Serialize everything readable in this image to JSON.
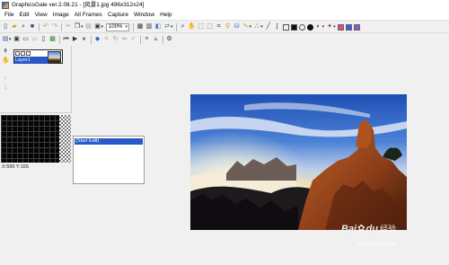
{
  "window": {
    "title": "GraphicsGale ver.2.08.21 - [风景1.jpg 496x312x24]"
  },
  "menu": {
    "items": [
      "File",
      "Edit",
      "View",
      "Image",
      "All Frames",
      "Capture",
      "Window",
      "Help"
    ]
  },
  "toolbar": {
    "zoom_value": "100%",
    "icons_row1_left": [
      "new-icon",
      "open-icon",
      "search-icon",
      "save-icon",
      "undo-icon",
      "redo-icon",
      "cut-icon",
      "copy-icon",
      "paste-icon",
      "frame-icon",
      "grid-icon",
      "table-icon",
      "layers-icon",
      "swap-icon"
    ],
    "icons_row1_right": [
      "zoom-icon",
      "hand-icon",
      "rect-select-icon",
      "lasso-icon",
      "crop-icon",
      "wand-icon",
      "bucket-icon",
      "brush-icon",
      "spray-icon",
      "line-icon",
      "curve-icon",
      "rect-icon",
      "fill-rect-icon",
      "circle-icon",
      "fill-circle-icon",
      "text-icon",
      "gradient-icon",
      "palette-icon"
    ],
    "color_chips": [
      "#e8458b",
      "#3b62d9",
      "#8d58c9"
    ]
  },
  "layer_panel": {
    "layer_name": "Layer1"
  },
  "history_panel": {
    "items": [
      "(Start Edit)"
    ]
  },
  "status": {
    "coordinates": "X:595 Y:165"
  },
  "watermark": {
    "brand": "Bai",
    "brand2": "du",
    "sub": "经验",
    "url": "jingyan.baidu.com"
  }
}
